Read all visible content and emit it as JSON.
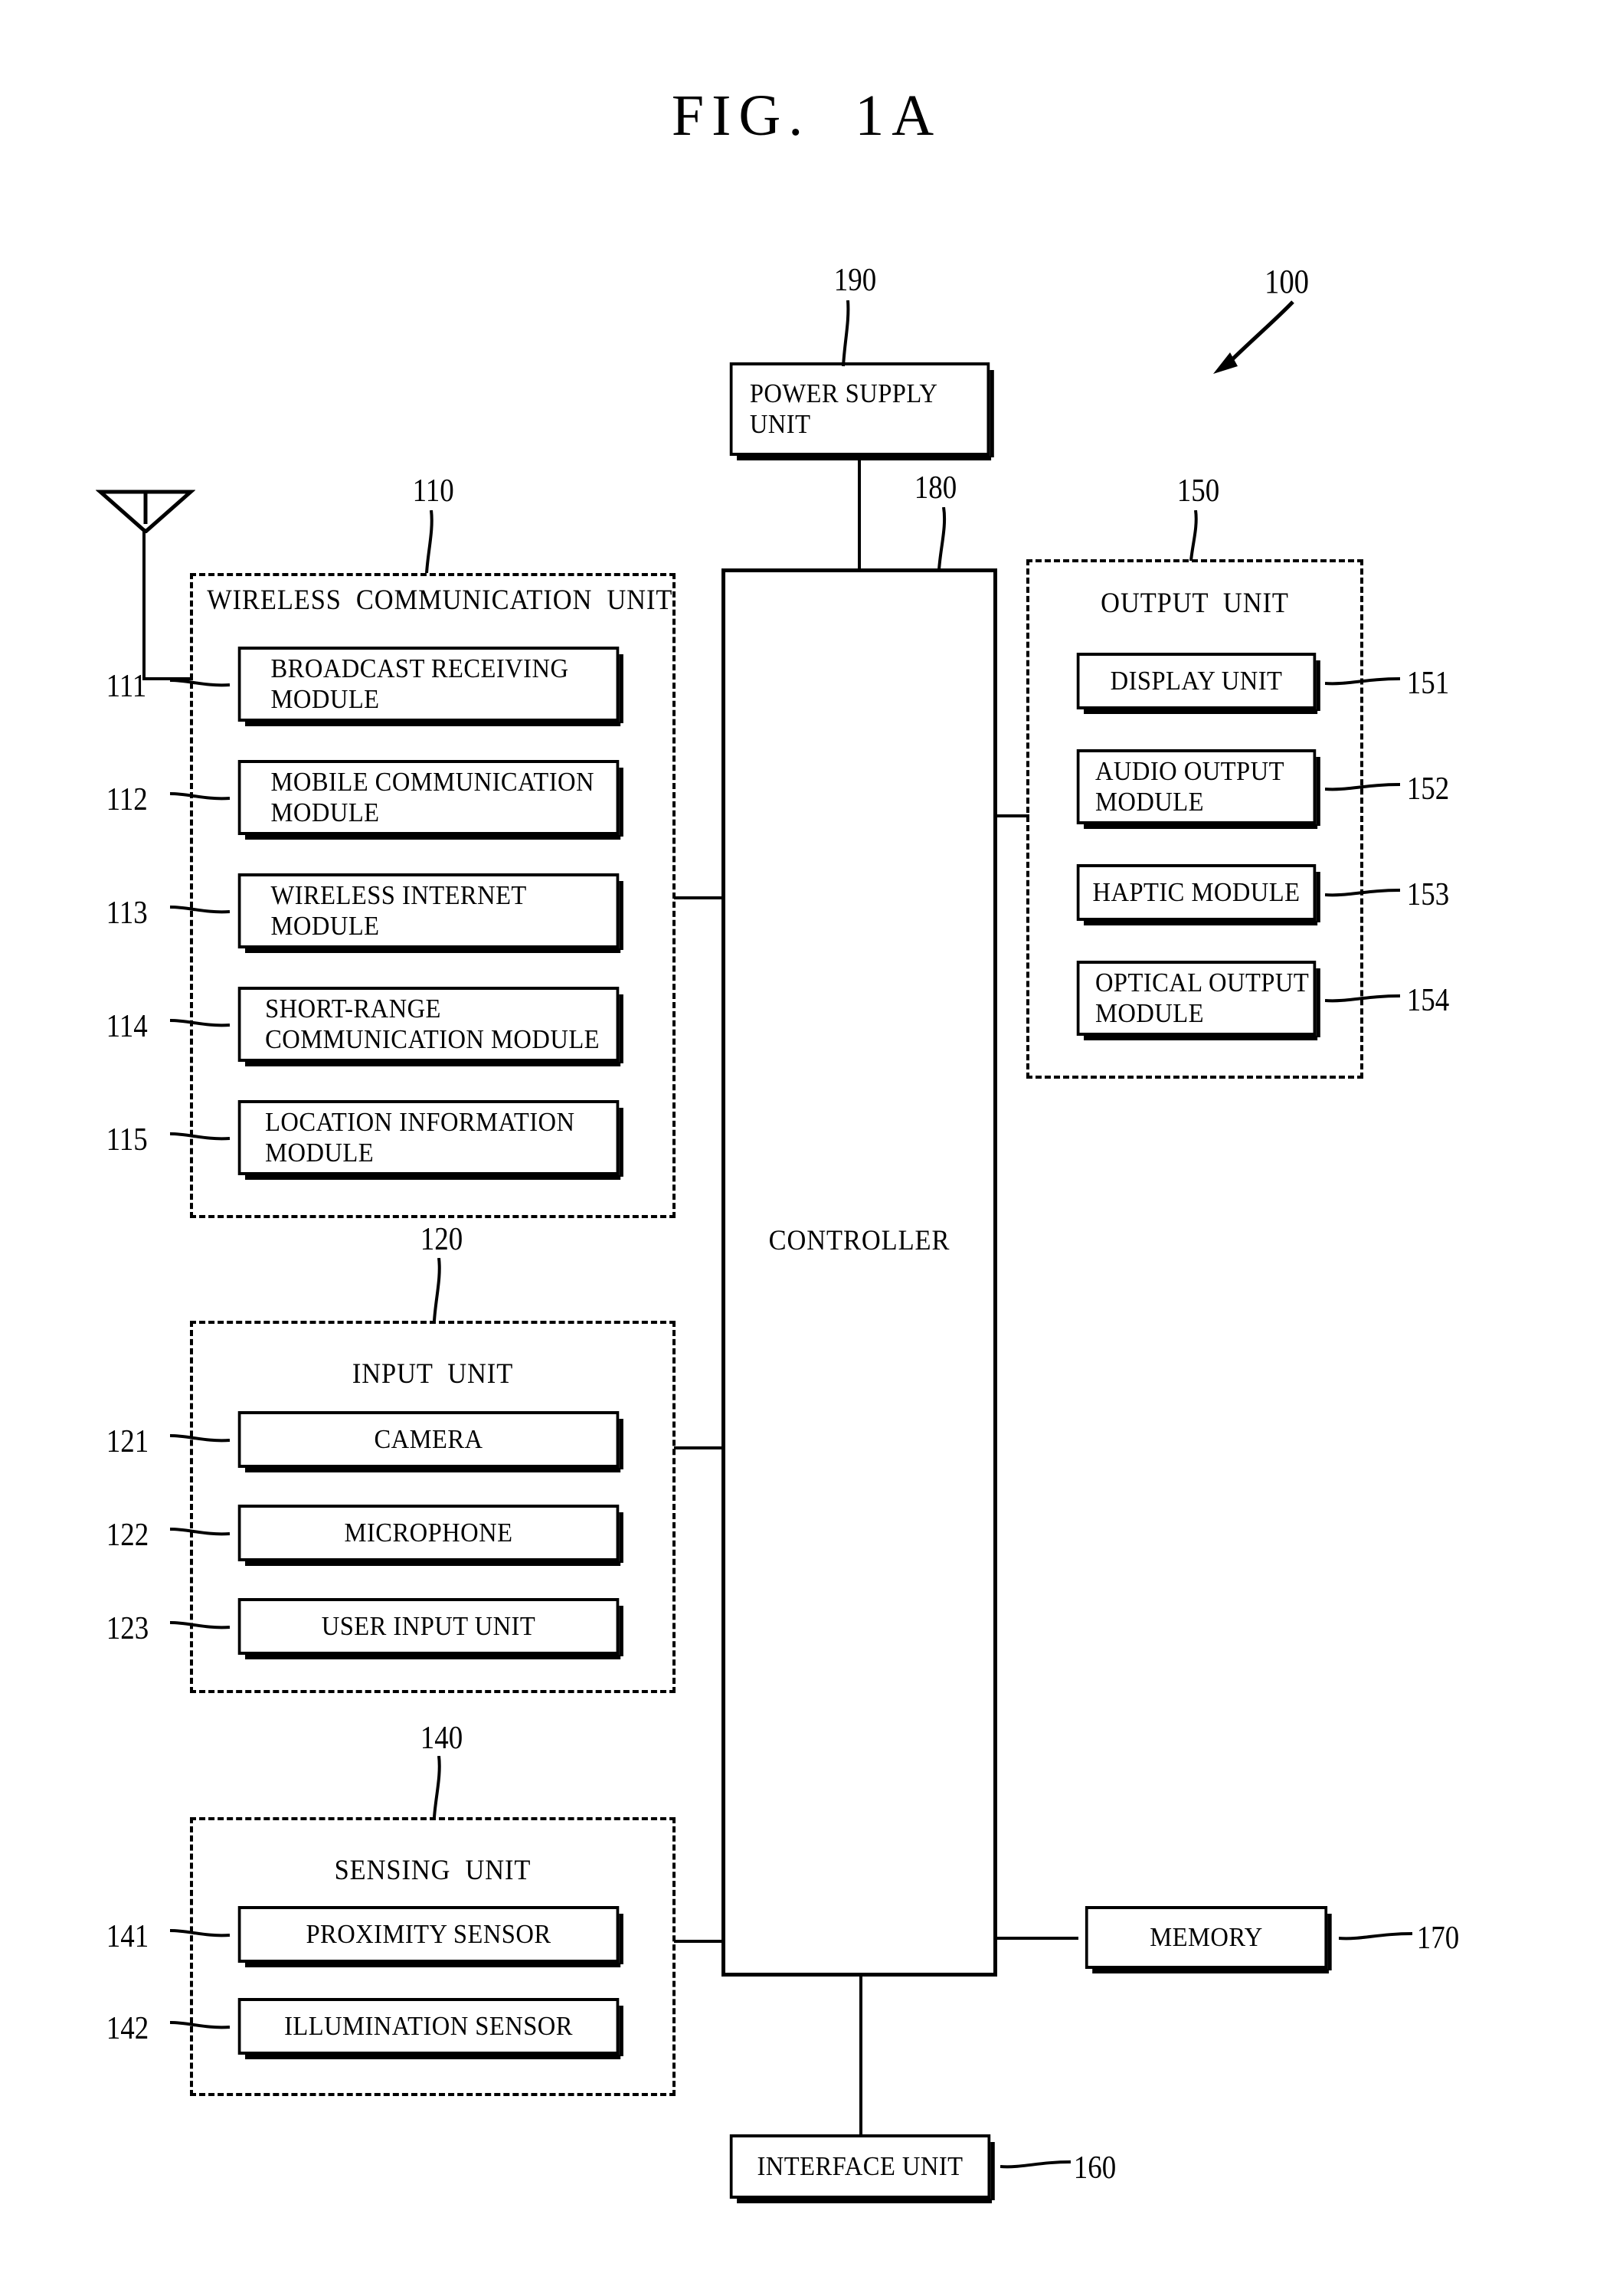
{
  "figure": {
    "title": "FIG.  1A",
    "overall_ref": "100"
  },
  "power_supply": {
    "label": "POWER SUPPLY\nUNIT",
    "ref": "190"
  },
  "controller": {
    "label": "CONTROLLER",
    "ref": "180"
  },
  "wireless_communication_unit": {
    "title": "WIRELESS  COMMUNICATION  UNIT",
    "ref": "110",
    "icon": "antenna-icon",
    "modules": [
      {
        "label": "BROADCAST  RECEIVING\nMODULE",
        "ref": "111"
      },
      {
        "label": "MOBILE  COMMUNICATION\nMODULE",
        "ref": "112"
      },
      {
        "label": "WIRELESS  INTERNET\nMODULE",
        "ref": "113"
      },
      {
        "label": "SHORT-RANGE\nCOMMUNICATION  MODULE",
        "ref": "114"
      },
      {
        "label": "LOCATION  INFORMATION\nMODULE",
        "ref": "115"
      }
    ]
  },
  "input_unit": {
    "title": "INPUT  UNIT",
    "ref": "120",
    "modules": [
      {
        "label": "CAMERA",
        "ref": "121"
      },
      {
        "label": "MICROPHONE",
        "ref": "122"
      },
      {
        "label": "USER  INPUT  UNIT",
        "ref": "123"
      }
    ]
  },
  "sensing_unit": {
    "title": "SENSING  UNIT",
    "ref": "140",
    "modules": [
      {
        "label": "PROXIMITY  SENSOR",
        "ref": "141"
      },
      {
        "label": "ILLUMINATION  SENSOR",
        "ref": "142"
      }
    ]
  },
  "output_unit": {
    "title": "OUTPUT  UNIT",
    "ref": "150",
    "modules": [
      {
        "label": "DISPLAY  UNIT",
        "ref": "151"
      },
      {
        "label": "AUDIO  OUTPUT\nMODULE",
        "ref": "152"
      },
      {
        "label": "HAPTIC  MODULE",
        "ref": "153"
      },
      {
        "label": "OPTICAL  OUTPUT\nMODULE",
        "ref": "154"
      }
    ]
  },
  "memory": {
    "label": "MEMORY",
    "ref": "170"
  },
  "interface_unit": {
    "label": "INTERFACE  UNIT",
    "ref": "160"
  },
  "colors": {
    "line": "#000000",
    "background": "#ffffff"
  }
}
